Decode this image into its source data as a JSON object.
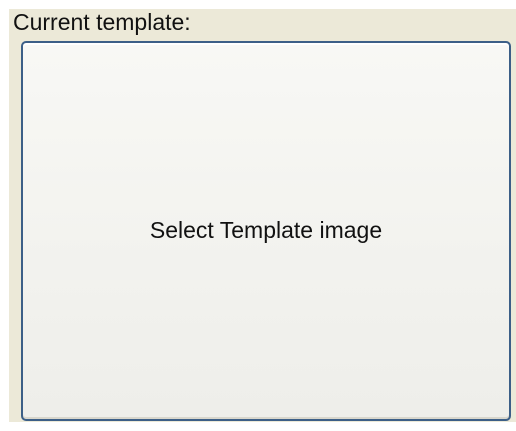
{
  "group": {
    "label": "Current template:"
  },
  "template_button": {
    "label": "Select Template image"
  }
}
